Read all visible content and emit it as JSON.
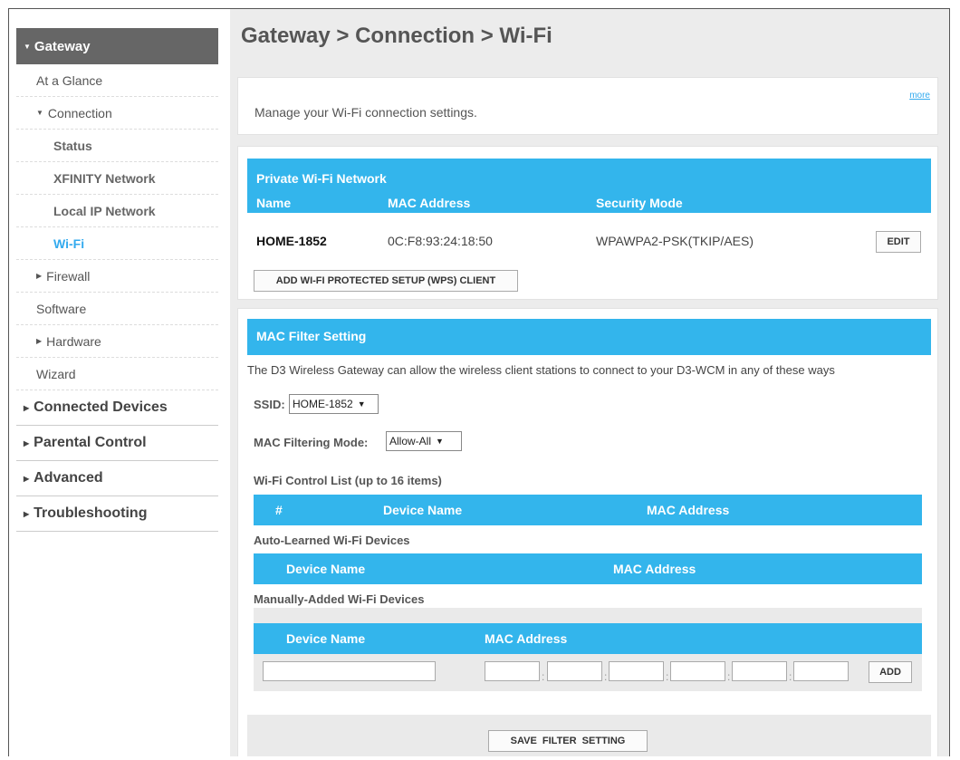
{
  "sidebar": {
    "top": "Gateway",
    "items": [
      {
        "label": "At a Glance",
        "level": "sub"
      },
      {
        "label": "Connection",
        "level": "sub",
        "expanded": true
      },
      {
        "label": "Status",
        "level": "sub2"
      },
      {
        "label": "XFINITY Network",
        "level": "sub2"
      },
      {
        "label": "Local IP Network",
        "level": "sub2"
      },
      {
        "label": "Wi-Fi",
        "level": "sub2",
        "active": true
      },
      {
        "label": "Firewall",
        "level": "sub",
        "collapsed": true
      },
      {
        "label": "Software",
        "level": "sub"
      },
      {
        "label": "Hardware",
        "level": "sub",
        "collapsed": true
      },
      {
        "label": "Wizard",
        "level": "sub"
      }
    ],
    "major": [
      "Connected Devices",
      "Parental Control",
      "Advanced",
      "Troubleshooting"
    ]
  },
  "header": {
    "title": "Gateway > Connection > Wi-Fi"
  },
  "intro": {
    "text": "Manage your Wi-Fi connection settings.",
    "more": "more"
  },
  "private": {
    "title": "Private Wi-Fi Network",
    "cols": {
      "name": "Name",
      "mac": "MAC Address",
      "security": "Security Mode"
    },
    "row": {
      "name": "HOME-1852",
      "mac": "0C:F8:93:24:18:50",
      "security": "WPAWPA2-PSK(TKIP/AES)"
    },
    "edit": "EDIT",
    "wps": "ADD WI-FI PROTECTED SETUP (WPS) CLIENT"
  },
  "mac": {
    "title": "MAC Filter Setting",
    "desc": "The D3 Wireless Gateway can allow the wireless client stations to connect to your D3-WCM in any of these ways",
    "ssid_label": "SSID:",
    "ssid_value": "HOME-1852",
    "mode_label": "MAC Filtering Mode:",
    "mode_value": "Allow-All",
    "control_title": "Wi-Fi Control List (up to 16 items)",
    "control_cols": {
      "num": "#",
      "device": "Device Name",
      "mac": "MAC Address"
    },
    "auto_title": "Auto-Learned Wi-Fi Devices",
    "auto_cols": {
      "device": "Device Name",
      "mac": "MAC Address"
    },
    "manual_title": "Manually-Added Wi-Fi Devices",
    "manual_cols": {
      "device": "Device Name",
      "mac": "MAC Address"
    },
    "add": "ADD",
    "save": "SAVE  FILTER  SETTING"
  },
  "colors": {
    "accent": "#33b5ec",
    "link": "#33aaee",
    "nav_top": "#666666"
  }
}
